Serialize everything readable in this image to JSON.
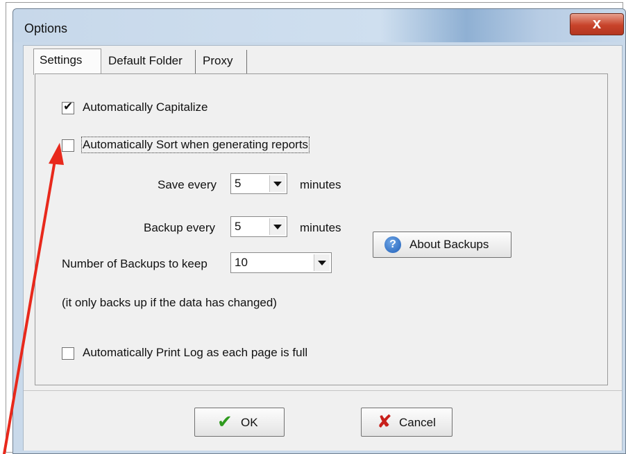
{
  "window": {
    "title": "Options",
    "close_label": "x"
  },
  "tabs": [
    {
      "label": "Settings",
      "active": true
    },
    {
      "label": "Default Folder",
      "active": false
    },
    {
      "label": "Proxy",
      "active": false
    }
  ],
  "settings": {
    "auto_capitalize": {
      "label": "Automatically Capitalize",
      "checked": true
    },
    "auto_sort": {
      "label": "Automatically Sort when generating reports",
      "checked": false
    },
    "save_every": {
      "label": "Save every",
      "value": "5",
      "unit": "minutes"
    },
    "backup_every": {
      "label": "Backup every",
      "value": "5",
      "unit": "minutes"
    },
    "backups_to_keep": {
      "label": "Number of Backups to keep",
      "value": "10"
    },
    "backup_note": "(it only backs up if the data has changed)",
    "auto_print_log": {
      "label": "Automatically Print Log as each page is full",
      "checked": false
    },
    "about_backups_label": "About Backups"
  },
  "buttons": {
    "ok_label": "OK",
    "cancel_label": "Cancel"
  },
  "colors": {
    "annotation_arrow": "#e8291c",
    "ok_icon": "#2e9a1e",
    "cancel_icon": "#c8201b"
  },
  "icons": [
    "info-icon",
    "checkmark-icon",
    "x-mark-icon",
    "chevron-down-icon"
  ]
}
